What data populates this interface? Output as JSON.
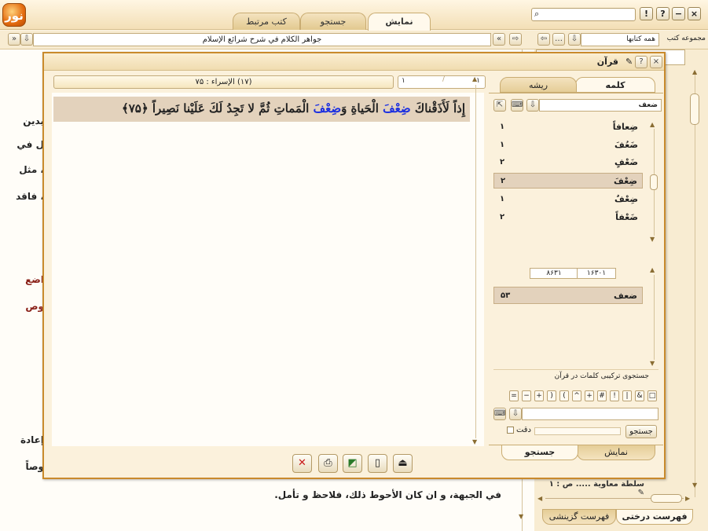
{
  "app": {
    "logo_text": "نور",
    "tabs": [
      {
        "label": "نمایش",
        "active": true
      },
      {
        "label": "جستجو",
        "active": false
      },
      {
        "label": "کتب مرتبط",
        "active": false
      }
    ],
    "window_buttons": [
      "?",
      "!",
      "−",
      "×"
    ]
  },
  "address_bar": {
    "book_title": "جواهر الكلام في شرح شرائع الإسلام",
    "collection_value": "همه کتابها",
    "collection_label": "مجموعه کتب"
  },
  "background_text": {
    "lines": [
      {
        "text": "يدين",
        "red": false
      },
      {
        "text": "ل في",
        "red": false
      },
      {
        "text": "، مثل",
        "red": false
      },
      {
        "text": "، فاقد",
        "red": false
      },
      {
        "text": "اضع",
        "red": true
      },
      {
        "text": "وص",
        "red": true
      },
      {
        "text": "إعادة",
        "red": false
      },
      {
        "text": "وصاً",
        "red": false
      },
      {
        "text": "في الجبهة، و ان كان الأحوط ذلك، فلاحظ و تأمل.",
        "red": false
      }
    ],
    "tree_item": "سلطة معاوية ..... ص : ۱",
    "bottom_tabs": [
      {
        "label": "فهرست درختی",
        "active": true
      },
      {
        "label": "فهرست گزینشی",
        "active": false
      }
    ]
  },
  "dialog": {
    "title": "قرآن",
    "verse_header": "(۱۷) الإسراء : ۷۵",
    "pager": {
      "current": "۱",
      "total": "۱"
    },
    "verse": {
      "before": "إِذاً لَأَذَقْناكَ ",
      "hl1": "ضِعْفَ",
      "mid1": " الْحَياةِ وَ",
      "hl2": "ضِعْفَ",
      "after": " الْمَماتِ ثُمَّ لا تَجِدُ لَكَ عَلَيْنا نَصِيراً ﴿۷۵﴾"
    },
    "toolbar_icons": [
      "close-icon",
      "print-icon",
      "export-icon",
      "copy-icon",
      "insert-icon"
    ],
    "right_pane": {
      "top_tabs": [
        {
          "label": "کلمه",
          "active": true
        },
        {
          "label": "ریشه",
          "active": false
        }
      ],
      "word_field": "ضعف",
      "words": [
        {
          "word": "ضِعافاً",
          "count": "۱",
          "selected": false
        },
        {
          "word": "ضَعُفَ",
          "count": "۱",
          "selected": false
        },
        {
          "word": "ضَعْفٍ",
          "count": "۲",
          "selected": false
        },
        {
          "word": "ضِعْفَ",
          "count": "۲",
          "selected": true
        },
        {
          "word": "ضِعْفٌ",
          "count": "۱",
          "selected": false
        },
        {
          "word": "ضَعْفاً",
          "count": "۲",
          "selected": false
        }
      ],
      "counts": {
        "left": "۸۶۳۱",
        "right": "۱۶۳۰۱"
      },
      "root": {
        "word": "ضعف",
        "count": "۵۳"
      },
      "combo_label": "جستجوی ترکیبی کلمات در قرآن",
      "operators": [
        "□",
        "&",
        "|",
        "!",
        "#",
        "+",
        "^",
        "(",
        ")",
        "+",
        "−",
        "="
      ],
      "search_button": "جستجو",
      "precision_label": "دقت",
      "bottom_tabs": [
        {
          "label": "نمایش",
          "active": false
        },
        {
          "label": "جستجو",
          "active": true
        }
      ]
    }
  }
}
